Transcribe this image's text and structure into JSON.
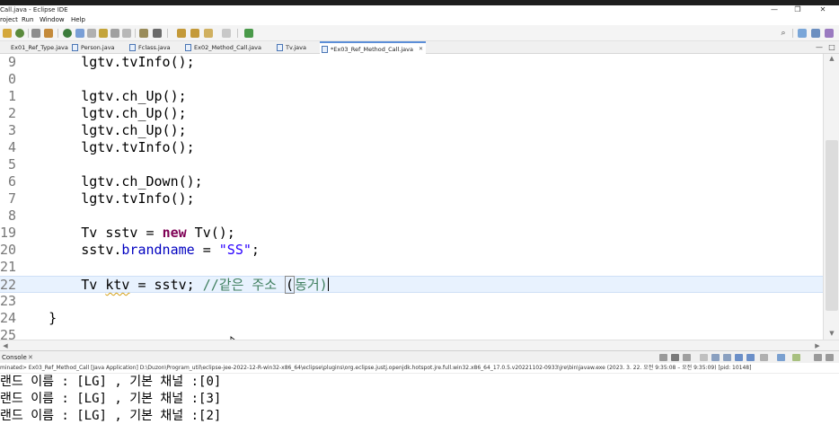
{
  "window": {
    "title": "Call.java - Eclipse IDE",
    "minimize": "—",
    "restore": "❐",
    "close": "✕"
  },
  "menu": [
    "roject",
    "Run",
    "Window",
    "Help"
  ],
  "editor_tabs": [
    {
      "label": "Ex01_Ref_Type.java",
      "active": false
    },
    {
      "label": "Person.java",
      "active": false
    },
    {
      "label": "Fclass.java",
      "active": false
    },
    {
      "label": "Ex02_Method_Call.java",
      "active": false
    },
    {
      "label": "Tv.java",
      "active": false
    },
    {
      "label": "*Ex03_Ref_Method_Call.java",
      "active": true
    }
  ],
  "tab_close": "✕",
  "tab_controls": {
    "minimize": "—",
    "maximize": "□"
  },
  "code_lines": [
    {
      "num": "9",
      "segments": [
        {
          "t": "        lgtv.tvInfo();",
          "c": "plain"
        }
      ]
    },
    {
      "num": "0",
      "segments": []
    },
    {
      "num": "1",
      "segments": [
        {
          "t": "        lgtv.ch_Up();",
          "c": "plain"
        }
      ]
    },
    {
      "num": "2",
      "segments": [
        {
          "t": "        lgtv.ch_Up();",
          "c": "plain"
        }
      ]
    },
    {
      "num": "3",
      "segments": [
        {
          "t": "        lgtv.ch_Up();",
          "c": "plain"
        }
      ]
    },
    {
      "num": "4",
      "segments": [
        {
          "t": "        lgtv.tvInfo();",
          "c": "plain"
        }
      ]
    },
    {
      "num": "5",
      "segments": []
    },
    {
      "num": "6",
      "segments": [
        {
          "t": "        lgtv.ch_Down();",
          "c": "plain"
        }
      ]
    },
    {
      "num": "7",
      "segments": [
        {
          "t": "        lgtv.tvInfo();",
          "c": "plain"
        }
      ]
    },
    {
      "num": "8",
      "segments": []
    },
    {
      "num": "19",
      "segments": [
        {
          "t": "        Tv sstv = ",
          "c": "plain"
        },
        {
          "t": "new",
          "c": "kw"
        },
        {
          "t": " Tv();",
          "c": "plain"
        }
      ]
    },
    {
      "num": "20",
      "segments": [
        {
          "t": "        sstv.",
          "c": "plain"
        },
        {
          "t": "brandname",
          "c": "fld"
        },
        {
          "t": " = ",
          "c": "plain"
        },
        {
          "t": "\"SS\"",
          "c": "str"
        },
        {
          "t": ";",
          "c": "plain"
        }
      ]
    },
    {
      "num": "21",
      "segments": []
    },
    {
      "num": "22",
      "current": true,
      "segments": [
        {
          "t": "        Tv ",
          "c": "plain"
        },
        {
          "t": "ktv",
          "c": "wavy"
        },
        {
          "t": " = sstv; ",
          "c": "plain"
        },
        {
          "t": "//같은 주소 ",
          "c": "cmt"
        },
        {
          "t": "(",
          "c": "bracket"
        },
        {
          "t": "동거)",
          "c": "cmt"
        },
        {
          "t": "",
          "c": "caret"
        }
      ]
    },
    {
      "num": "23",
      "segments": []
    },
    {
      "num": "24",
      "segments": [
        {
          "t": "    }",
          "c": "plain"
        }
      ]
    },
    {
      "num": "25",
      "segments": []
    }
  ],
  "console": {
    "tab_label": "Console",
    "close": "✕",
    "status": "minated> Ex03_Ref_Method_Call [Java Application] D:\\Duzon\\Program_util\\eclipse-jee-2022-12-R-win32-x86_64\\eclipse\\plugins\\org.eclipse.justj.openjdk.hotspot.jre.full.win32.x86_64_17.0.5.v20221102-0933\\jre\\bin\\javaw.exe  (2023. 3. 22. 오전 9:35:08 – 오전 9:35:09) [pid: 10148]",
    "output": [
      "랜드 이름 : [LG] , 기본 채널 :[0]",
      "랜드 이름 : [LG] , 기본 채널 :[3]",
      "랜드 이름 : [LG] , 기본 채널 :[2]"
    ]
  },
  "colors": {
    "keyword": "#7f0055",
    "string": "#2a00ff",
    "field": "#0000c0",
    "comment": "#3f7f5f",
    "current_line": "#e8f2fe"
  },
  "icons": [
    "save-icon",
    "new-icon",
    "debug-icon",
    "run-icon",
    "search-icon",
    "perspective-icon",
    "terminate-icon",
    "pin-icon"
  ]
}
